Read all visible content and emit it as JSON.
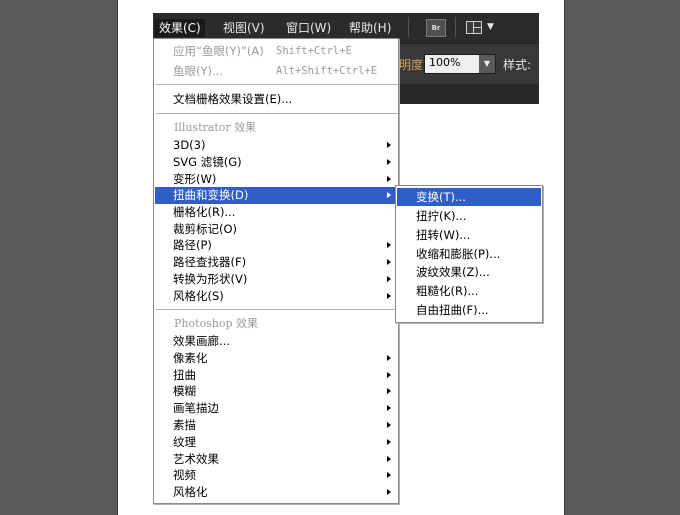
{
  "menubar": {
    "items": [
      {
        "label": "效果(C)",
        "active": true
      },
      {
        "label": "视图(V)",
        "active": false
      },
      {
        "label": "窗口(W)",
        "active": false
      },
      {
        "label": "帮助(H)",
        "active": false
      }
    ],
    "bridge_label": "Br"
  },
  "controlbar": {
    "opacity_label": "明度",
    "opacity_value": "100%",
    "style_label": "样式:"
  },
  "effect_menu": {
    "apply_last": {
      "label": "应用“鱼眼(Y)”(A)",
      "shortcut": "Shift+Ctrl+E"
    },
    "last_effect": {
      "label": "鱼眼(Y)...",
      "shortcut": "Alt+Shift+Ctrl+E"
    },
    "raster_settings": "文档栅格效果设置(E)...",
    "illustrator_header": "Illustrator 效果",
    "illustrator_items": [
      {
        "label": "3D(3)",
        "submenu": true
      },
      {
        "label": "SVG 滤镜(G)",
        "submenu": true
      },
      {
        "label": "变形(W)",
        "submenu": true
      },
      {
        "label": "扭曲和变换(D)",
        "submenu": true,
        "highlight": true
      },
      {
        "label": "栅格化(R)...",
        "submenu": false
      },
      {
        "label": "裁剪标记(O)",
        "submenu": false
      },
      {
        "label": "路径(P)",
        "submenu": true
      },
      {
        "label": "路径查找器(F)",
        "submenu": true
      },
      {
        "label": "转换为形状(V)",
        "submenu": true
      },
      {
        "label": "风格化(S)",
        "submenu": true
      }
    ],
    "photoshop_header": "Photoshop 效果",
    "photoshop_items": [
      {
        "label": "效果画廊...",
        "submenu": false
      },
      {
        "label": "像素化",
        "submenu": true
      },
      {
        "label": "扭曲",
        "submenu": true
      },
      {
        "label": "模糊",
        "submenu": true
      },
      {
        "label": "画笔描边",
        "submenu": true
      },
      {
        "label": "素描",
        "submenu": true
      },
      {
        "label": "纹理",
        "submenu": true
      },
      {
        "label": "艺术效果",
        "submenu": true
      },
      {
        "label": "视频",
        "submenu": true
      },
      {
        "label": "风格化",
        "submenu": true
      }
    ]
  },
  "distort_submenu": {
    "items": [
      {
        "label": "变换(T)...",
        "highlight": true
      },
      {
        "label": "扭拧(K)..."
      },
      {
        "label": "扭转(W)..."
      },
      {
        "label": "收缩和膨胀(P)..."
      },
      {
        "label": "波纹效果(Z)..."
      },
      {
        "label": "粗糙化(R)..."
      },
      {
        "label": "自由扭曲(F)..."
      }
    ]
  },
  "icons": {
    "submenu_arrow": "chevron-right-icon",
    "workspace": "workspace-layout-icon",
    "dropdown": "caret-down-icon"
  },
  "colors": {
    "highlight": "#2f5fc6",
    "menubar_bg": "#2b2b2b",
    "disabled_text": "#9a9a9a",
    "opacity_label": "#d9a35b"
  }
}
